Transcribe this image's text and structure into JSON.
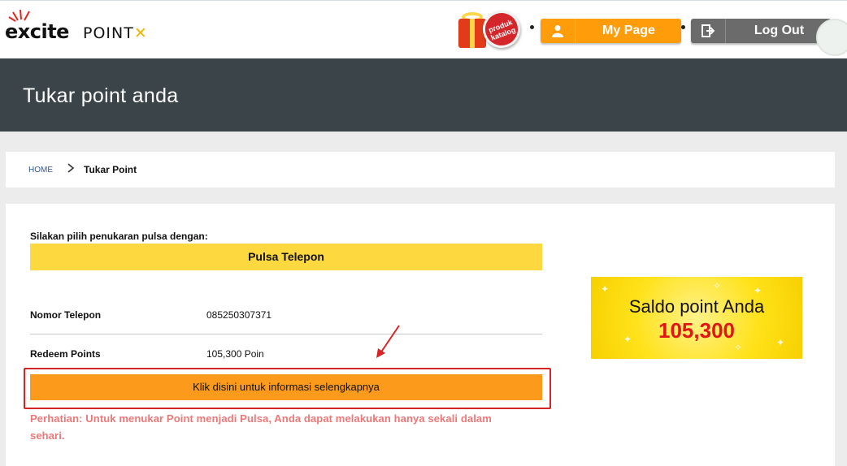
{
  "header": {
    "logo_excite": "excite",
    "logo_point": "POINT",
    "catalog_badge": "produk katalog",
    "mypage_label": "My Page",
    "logout_label": "Log Out"
  },
  "banner": {
    "title": "Tukar point anda"
  },
  "breadcrumb": {
    "home": "HOME",
    "current": "Tukar Point"
  },
  "form": {
    "intro": "Silakan pilih penukaran pulsa dengan:",
    "selected_option": "Pulsa Telepon",
    "phone_label": "Nomor Telepon",
    "phone_value": "085250307371",
    "redeem_label": "Redeem Points",
    "redeem_value": "105,300 Poin",
    "info_button": "Klik disini untuk informasi selengkapnya",
    "notice": "Perhatian: Untuk menukar Point menjadi Pulsa, Anda dapat melakukan hanya sekali dalam sehari."
  },
  "balance": {
    "label": "Saldo point Anda",
    "value": "105,300"
  },
  "colors": {
    "accent_orange": "#fb9a1b",
    "highlight_yellow": "#fdd83f",
    "banner_dark": "#3b4449",
    "notice_red": "#ee7878",
    "balance_red": "#e01616",
    "annotation_red": "#d42424"
  },
  "icons": [
    "user-icon",
    "logout-icon",
    "chevron-right-icon",
    "gift-icon"
  ]
}
